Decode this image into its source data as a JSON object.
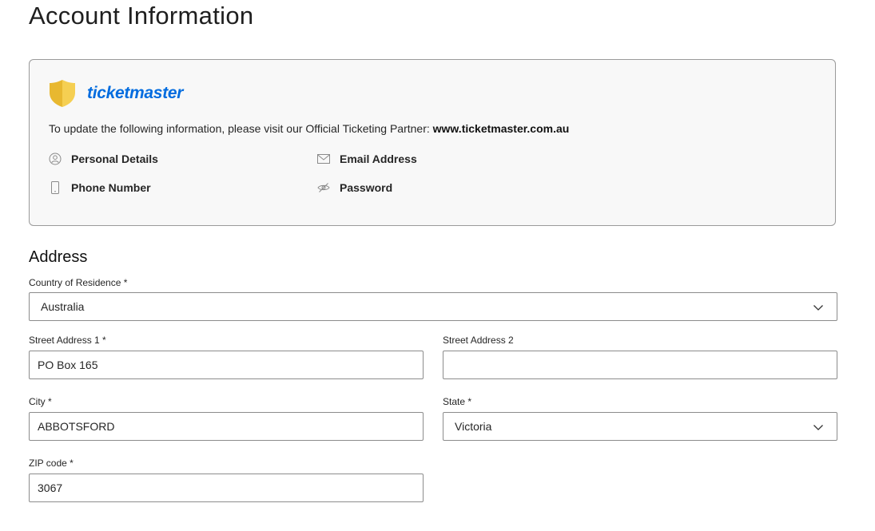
{
  "page": {
    "title": "Account Information"
  },
  "ticketmaster_card": {
    "brand": "ticketmaster",
    "brand_color": "#026cdf",
    "shield_colors": [
      "#e8b830",
      "#f5cf52"
    ],
    "note_prefix": "To update the following information, please visit our Official Ticketing Partner: ",
    "note_link": "www.ticketmaster.com.au",
    "items": [
      {
        "label": "Personal Details",
        "icon": "user-circle-icon"
      },
      {
        "label": "Email Address",
        "icon": "envelope-icon"
      },
      {
        "label": "Phone Number",
        "icon": "mobile-phone-icon"
      },
      {
        "label": "Password",
        "icon": "eye-slash-icon"
      }
    ]
  },
  "address": {
    "title": "Address",
    "country": {
      "label": "Country of Residence *",
      "value": "Australia"
    },
    "street1": {
      "label": "Street Address 1 *",
      "value": "PO Box 165"
    },
    "street2": {
      "label": "Street Address 2",
      "value": ""
    },
    "city": {
      "label": "City *",
      "value": "ABBOTSFORD"
    },
    "state": {
      "label": "State *",
      "value": "Victoria"
    },
    "zip": {
      "label": "ZIP code *",
      "value": "3067"
    }
  }
}
